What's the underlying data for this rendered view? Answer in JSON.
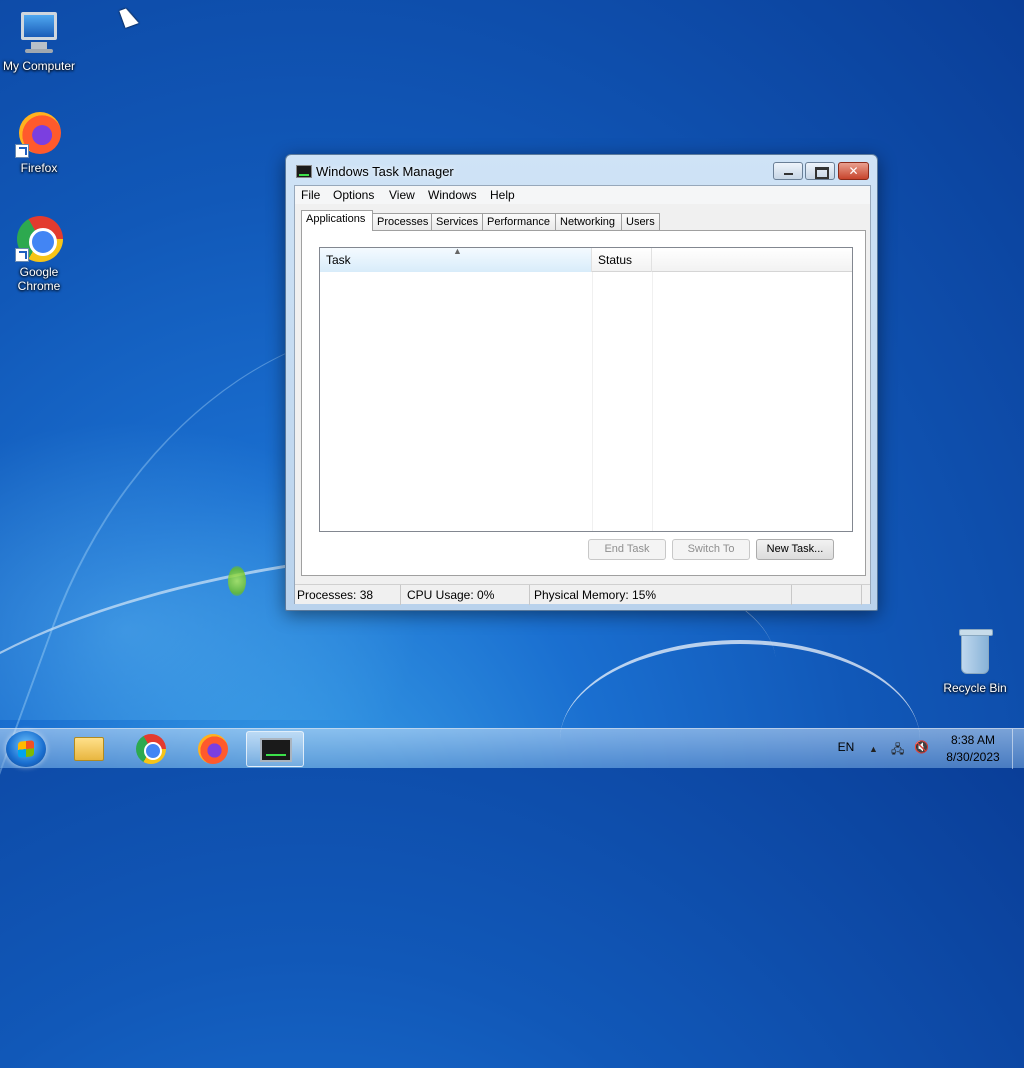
{
  "desktop": {
    "icons": [
      {
        "label": "My Computer",
        "icon": "computer-icon"
      },
      {
        "label": "Firefox",
        "icon": "firefox-icon"
      },
      {
        "label": "Google Chrome",
        "icon": "chrome-icon"
      },
      {
        "label": "Recycle Bin",
        "icon": "recycle-bin-icon"
      }
    ]
  },
  "window": {
    "title": "Windows Task Manager",
    "menu": [
      "File",
      "Options",
      "View",
      "Windows",
      "Help"
    ],
    "tabs": [
      "Applications",
      "Processes",
      "Services",
      "Performance",
      "Networking",
      "Users"
    ],
    "active_tab": "Applications",
    "list": {
      "columns": [
        "Task",
        "Status"
      ],
      "rows": []
    },
    "buttons": {
      "end_task": "End Task",
      "switch_to": "Switch To",
      "new_task": "New Task..."
    },
    "status": {
      "processes": "Processes: 38",
      "cpu": "CPU Usage: 0%",
      "memory": "Physical Memory: 15%"
    }
  },
  "taskbar": {
    "apps": [
      "file-explorer-icon",
      "chrome-icon",
      "firefox-icon",
      "task-manager-icon"
    ],
    "tray": {
      "language": "EN",
      "time": "8:38 AM",
      "date": "8/30/2023"
    }
  },
  "colors": {
    "desktop_blue": "#1158b8",
    "close_red": "#c7442c",
    "title_glass": "#cfe3f6"
  }
}
